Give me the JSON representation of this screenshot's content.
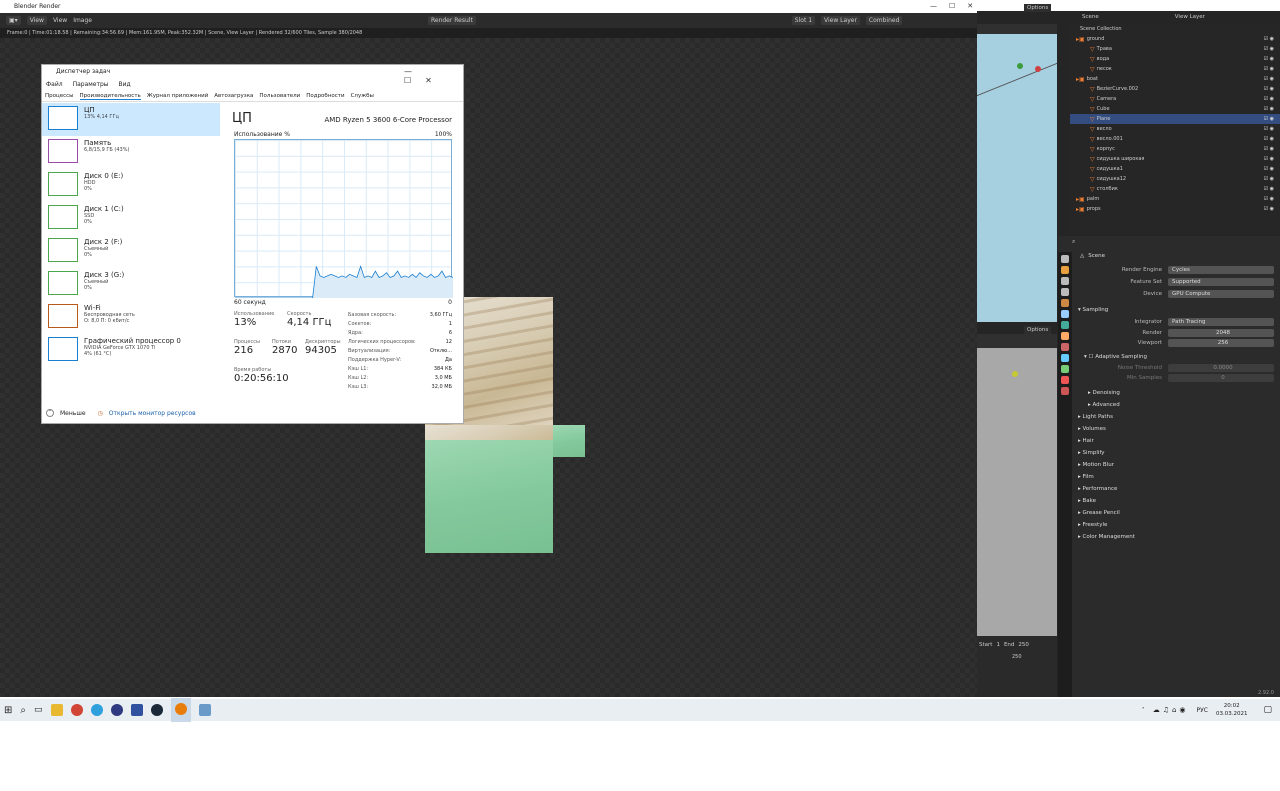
{
  "render_window": {
    "title": "Blender Render",
    "menu": {
      "view1": "View",
      "view2": "View",
      "image": "Image",
      "slot_selector": "Render Result",
      "slot": "Slot 1",
      "layer": "View Layer",
      "pass": "Combined"
    },
    "status": "Frame:0 | Time:01:18.58 | Remaining:34:56.69 | Mem:161.95M, Peak:352.32M | Scene, View Layer | Rendered 32/600 Tiles, Sample 380/2048"
  },
  "task_manager": {
    "title": "Диспетчер задач",
    "menu": [
      "Файл",
      "Параметры",
      "Вид"
    ],
    "tabs": [
      "Процессы",
      "Производительность",
      "Журнал приложений",
      "Автозагрузка",
      "Пользователи",
      "Подробности",
      "Службы"
    ],
    "active_tab": 1,
    "resources": [
      {
        "name": "ЦП",
        "sub1": "13% 4,14 ГГц",
        "sub2": "",
        "color": "#1a7fd0"
      },
      {
        "name": "Память",
        "sub1": "6,8/15,9 ГБ (43%)",
        "sub2": "",
        "color": "#9a4ba8"
      },
      {
        "name": "Диск 0 (E:)",
        "sub1": "HDD",
        "sub2": "0%",
        "color": "#4ca64c"
      },
      {
        "name": "Диск 1 (C:)",
        "sub1": "SSD",
        "sub2": "0%",
        "color": "#4ca64c"
      },
      {
        "name": "Диск 2 (F:)",
        "sub1": "Съемный",
        "sub2": "0%",
        "color": "#4ca64c"
      },
      {
        "name": "Диск 3 (G:)",
        "sub1": "Съемный",
        "sub2": "0%",
        "color": "#4ca64c"
      },
      {
        "name": "Wi-Fi",
        "sub1": "Беспроводная сеть",
        "sub2": "О: 8,0 П: 0 кбит/с",
        "color": "#b85a1a"
      },
      {
        "name": "Графический процессор 0",
        "sub1": "NVIDIA GeForce GTX 1070 Ti",
        "sub2": "4% (61 °C)",
        "color": "#1a7fd0"
      }
    ],
    "cpu": {
      "heading": "ЦП",
      "processor": "AMD Ryzen 5 3600 6-Core Processor",
      "graph_label": "Использование %",
      "graph_max": "100%",
      "graph_time": "60 секунд",
      "graph_min": "0",
      "usage_label": "Использование",
      "usage": "13%",
      "speed_label": "Скорость",
      "speed": "4,14 ГГц",
      "proc_label": "Процессы",
      "procs": "216",
      "threads_label": "Потоки",
      "threads": "2870",
      "handles_label": "Дескрипторы",
      "handles": "94305",
      "uptime_label": "Время работы",
      "uptime": "0:20:56:10",
      "usage_series": [
        0,
        0,
        0,
        0,
        0,
        0,
        0,
        0,
        0,
        0,
        0,
        0,
        0,
        0,
        0,
        0,
        0,
        0,
        0,
        0,
        0,
        0,
        20,
        14,
        13,
        14,
        15,
        14,
        13,
        14,
        13,
        15,
        14,
        13,
        20,
        13,
        14,
        13,
        17,
        13,
        14,
        16,
        13,
        14,
        17,
        13,
        14,
        13,
        15,
        13,
        16,
        14,
        13,
        15,
        13,
        14,
        17,
        13,
        14,
        13
      ],
      "specs": [
        [
          "Базовая скорость:",
          "3,60 ГГц"
        ],
        [
          "Сокетов:",
          "1"
        ],
        [
          "Ядра:",
          "6"
        ],
        [
          "Логических процессоров:",
          "12"
        ],
        [
          "Виртуализация:",
          "Отклю..."
        ],
        [
          "Поддержка Hyper-V:",
          "Да"
        ],
        [
          "Кэш L1:",
          "384 КБ"
        ],
        [
          "Кэш L2:",
          "3,0 МБ"
        ],
        [
          "Кэш L3:",
          "32,0 МБ"
        ]
      ]
    },
    "footer": {
      "less": "Меньше",
      "monitor": "Открыть монитор ресурсов"
    }
  },
  "outliner": {
    "scene": "Scene",
    "view_layer": "View Layer",
    "collection": "Scene Collection",
    "rows": [
      "ground",
      "Трава",
      "вода",
      "песок",
      "boat",
      "BezierCurve.002",
      "Camera",
      "Cube",
      "Plane",
      "весло",
      "весло.001",
      "корпус",
      "сидушка широкая",
      "сидушка1",
      "сидушка12",
      "столбик",
      "palm",
      "props"
    ]
  },
  "properties": {
    "scene": "Scene",
    "render_engine_label": "Render Engine",
    "render_engine": "Cycles",
    "feature_set_label": "Feature Set",
    "feature_set": "Supported",
    "device_label": "Device",
    "device": "GPU Compute",
    "sampling": "Sampling",
    "integrator_label": "Integrator",
    "integrator": "Path Tracing",
    "render_label": "Render",
    "render": "2048",
    "viewport_label": "Viewport",
    "viewport": "256",
    "adaptive": "Adaptive Sampling",
    "noise_label": "Noise Threshold",
    "noise": "0.0000",
    "min_label": "Min Samples",
    "min": "0",
    "panels": [
      "Denoising",
      "Advanced",
      "Light Paths",
      "Volumes",
      "Hair",
      "Simplify",
      "Motion Blur",
      "Film",
      "Performance",
      "Bake",
      "Grease Pencil",
      "Freestyle",
      "Color Management"
    ]
  },
  "viewport": {
    "options": "Options",
    "start": "Start",
    "start_val": "1",
    "end": "End",
    "end_val": "250",
    "tick": "250"
  },
  "taskbar": {
    "lang": "РУС",
    "time": "20:02",
    "date": "03.03.2021"
  },
  "version": "2.92.0"
}
